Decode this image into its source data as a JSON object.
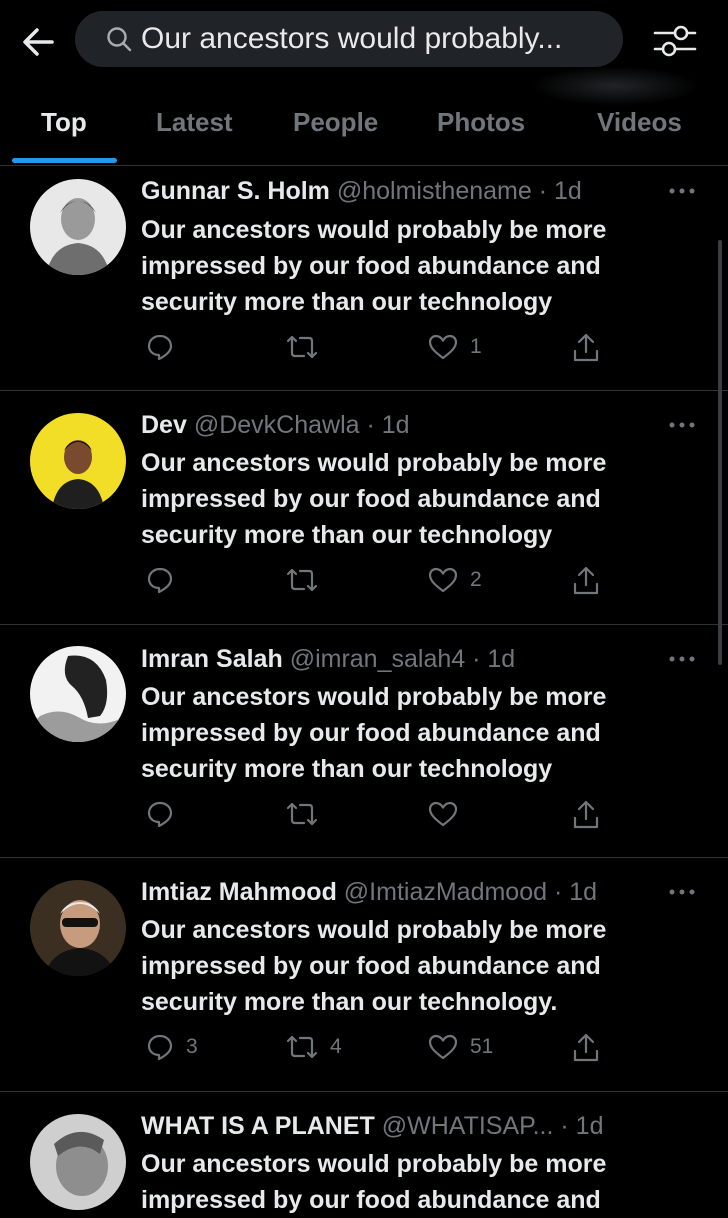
{
  "search": {
    "query": "Our ancestors would probably..."
  },
  "tabs": [
    {
      "label": "Top",
      "active": true
    },
    {
      "label": "Latest",
      "active": false
    },
    {
      "label": "People",
      "active": false
    },
    {
      "label": "Photos",
      "active": false
    },
    {
      "label": "Videos",
      "active": false
    }
  ],
  "colors": {
    "accent": "#1d9bf0",
    "background": "#000000",
    "muted": "#71767b"
  },
  "tweets": [
    {
      "name": "Gunnar S. Holm",
      "handle": "@holmisthename",
      "time": "· 1d",
      "text": "Our ancestors would probably be more impressed by our food abundance and security more than our technology",
      "replies": "",
      "retweets": "",
      "likes": "1"
    },
    {
      "name": "Dev",
      "handle": "@DevkChawla",
      "time": "· 1d",
      "text": "Our ancestors would probably be more impressed by our food abundance and security more than our technology",
      "replies": "",
      "retweets": "",
      "likes": "2"
    },
    {
      "name": "Imran Salah",
      "handle": "@imran_salah4",
      "time": "· 1d",
      "text": "Our ancestors would probably be more impressed by our food abundance and security more than our technology",
      "replies": "",
      "retweets": "",
      "likes": ""
    },
    {
      "name": "Imtiaz Mahmood",
      "handle": "@ImtiazMadmood",
      "time": "· 1d",
      "text": "Our ancestors would probably be more impressed by our food abundance and security more than our technology.",
      "replies": "3",
      "retweets": "4",
      "likes": "51"
    },
    {
      "name": "WHAT IS A PLANET",
      "handle": "@WHATISAP...",
      "time": "· 1d",
      "text": "Our ancestors would probably be more impressed by our food abundance and",
      "replies": "",
      "retweets": "",
      "likes": ""
    }
  ]
}
